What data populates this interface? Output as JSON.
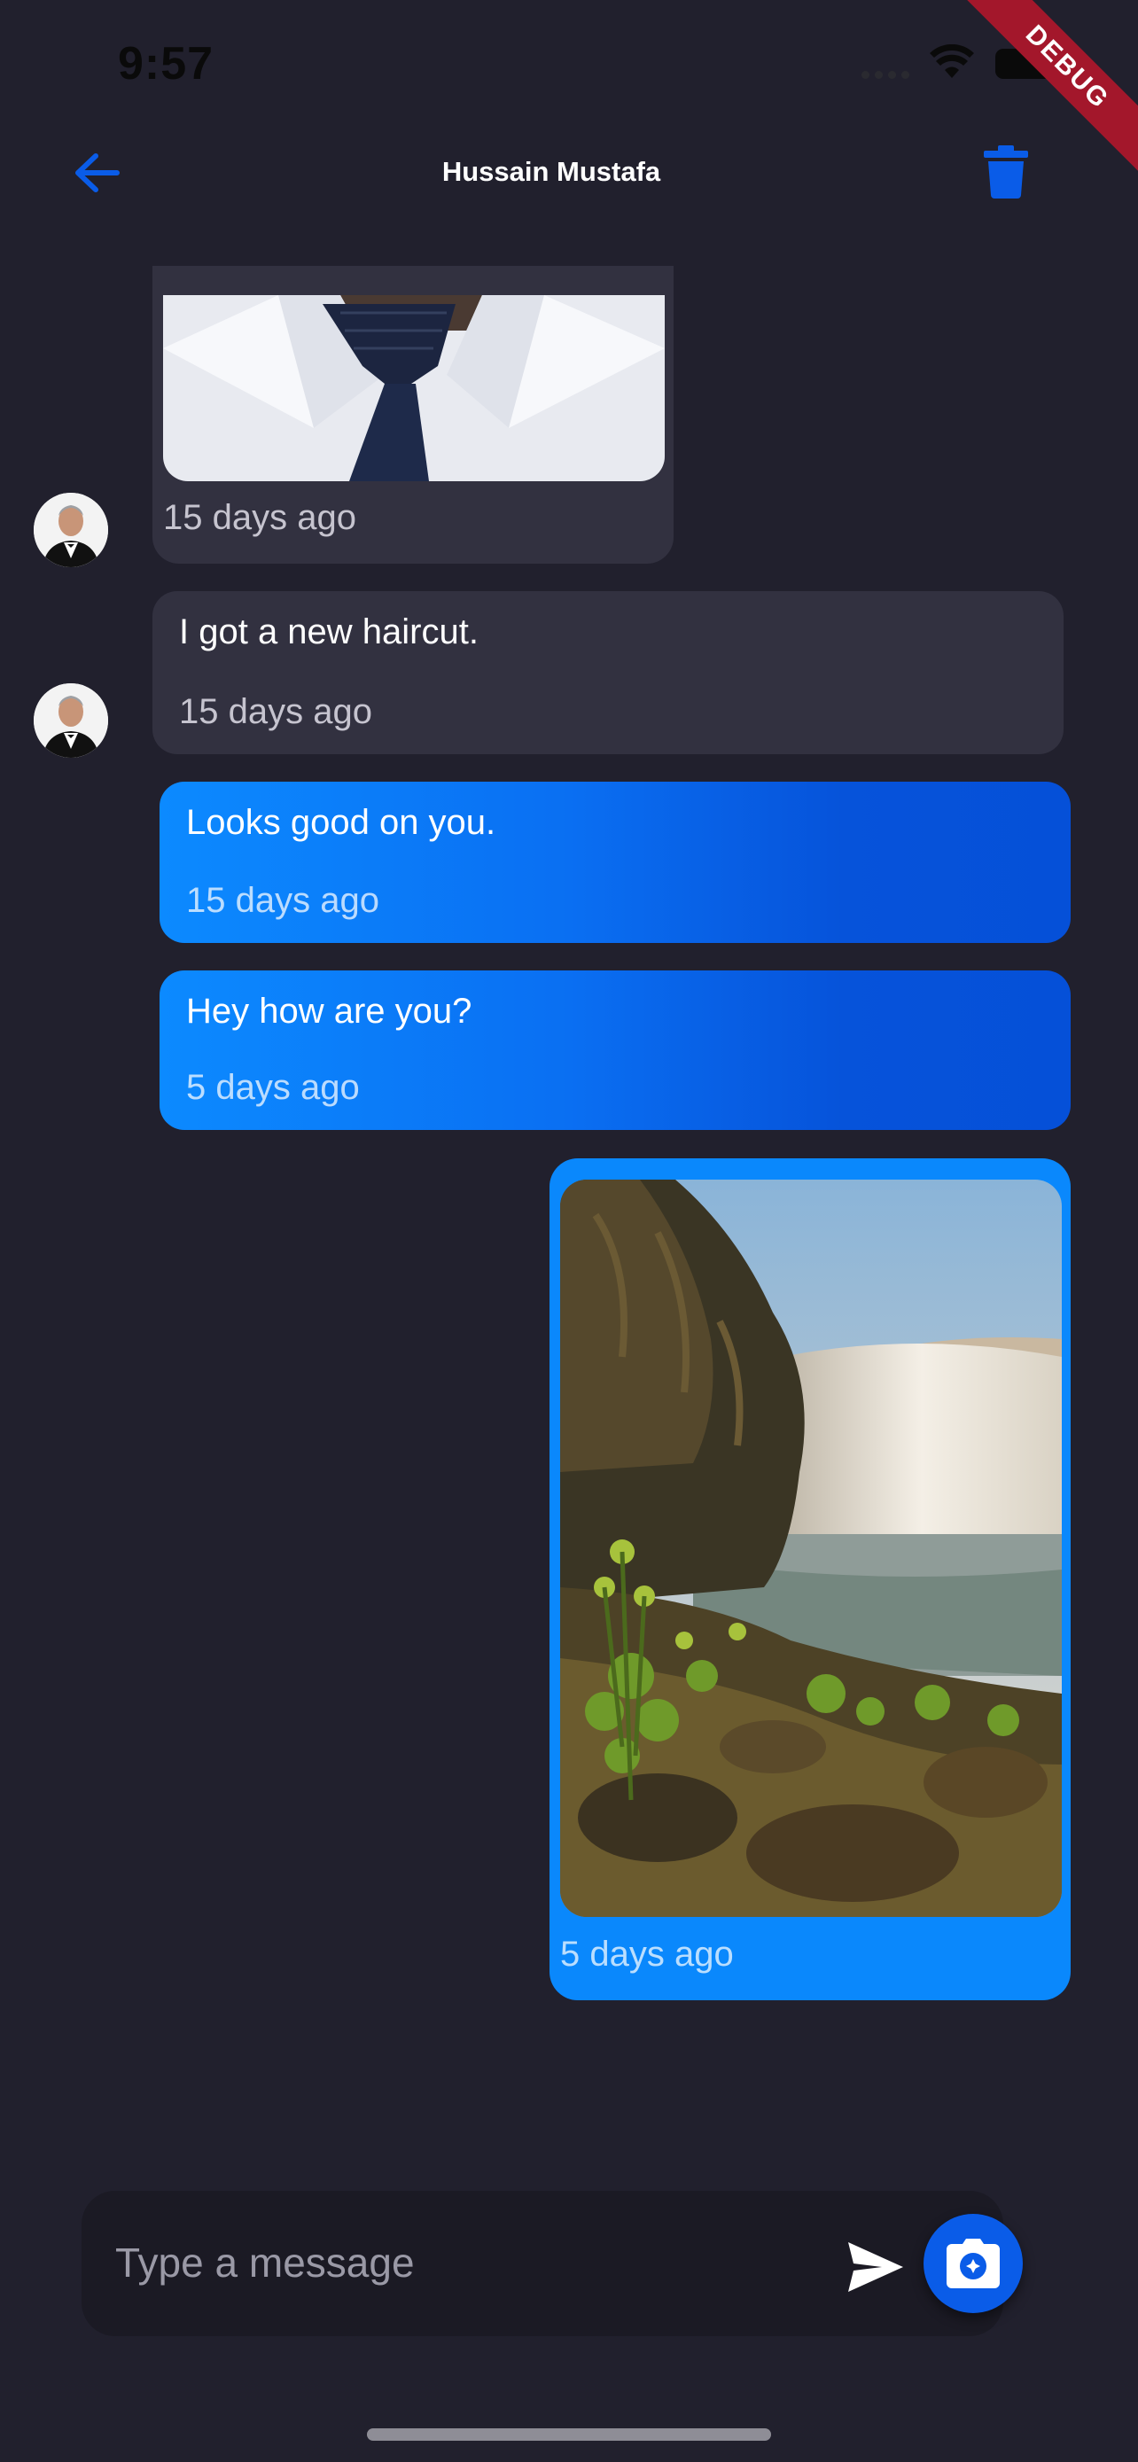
{
  "status_bar": {
    "time": "9:57"
  },
  "debug_banner": "DEBUG",
  "header": {
    "title": "Hussain Mustafa",
    "back_icon": "back-arrow-icon",
    "delete_icon": "trash-icon"
  },
  "messages": [
    {
      "type": "image",
      "direction": "incoming",
      "image": "man-in-white-shirt-and-tie",
      "time": "15 days ago"
    },
    {
      "type": "text",
      "direction": "incoming",
      "text": "I got a new haircut.",
      "time": "15 days ago"
    },
    {
      "type": "text",
      "direction": "outgoing",
      "text": "Looks good on you.",
      "time": "15 days ago"
    },
    {
      "type": "text",
      "direction": "outgoing",
      "text": "Hey how are you?",
      "time": "5 days ago"
    },
    {
      "type": "image",
      "direction": "outgoing",
      "image": "waterfall-landscape",
      "time": "5 days ago"
    }
  ],
  "composer": {
    "placeholder": "Type a message",
    "send_icon": "send-icon",
    "camera_icon": "camera-icon"
  },
  "colors": {
    "background": "#21202d",
    "incoming_bubble": "#323140",
    "outgoing_start": "#0c8aff",
    "outgoing_end": "#0550d8",
    "accent": "#0a5ce8"
  }
}
